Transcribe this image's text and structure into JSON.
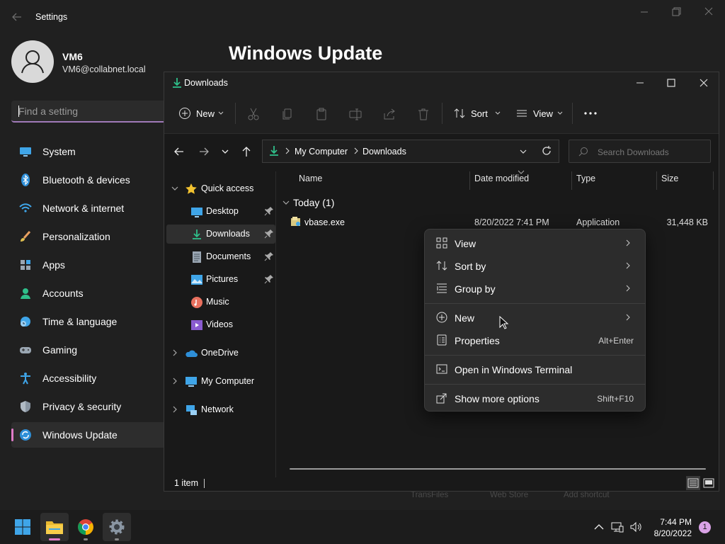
{
  "settings": {
    "app_title": "Settings",
    "user": {
      "name": "VM6",
      "email": "VM6@collabnet.local"
    },
    "search_placeholder": "Find a setting",
    "page_title": "Windows Update",
    "nav": [
      {
        "label": "System",
        "icon": "monitor-icon"
      },
      {
        "label": "Bluetooth & devices",
        "icon": "bluetooth-icon"
      },
      {
        "label": "Network & internet",
        "icon": "wifi-icon"
      },
      {
        "label": "Personalization",
        "icon": "brush-icon"
      },
      {
        "label": "Apps",
        "icon": "apps-icon"
      },
      {
        "label": "Accounts",
        "icon": "person-icon"
      },
      {
        "label": "Time & language",
        "icon": "clock-globe-icon"
      },
      {
        "label": "Gaming",
        "icon": "gamepad-icon"
      },
      {
        "label": "Accessibility",
        "icon": "accessibility-icon"
      },
      {
        "label": "Privacy & security",
        "icon": "shield-icon"
      },
      {
        "label": "Windows Update",
        "icon": "update-icon",
        "active": true
      }
    ]
  },
  "explorer": {
    "title": "Downloads",
    "toolbar": {
      "new": "New",
      "sort": "Sort",
      "view": "View"
    },
    "breadcrumb": [
      "My Computer",
      "Downloads"
    ],
    "search_placeholder": "Search Downloads",
    "tree": {
      "quick_access": "Quick access",
      "items": [
        "Desktop",
        "Downloads",
        "Documents",
        "Pictures",
        "Music",
        "Videos"
      ],
      "onedrive": "OneDrive",
      "my_computer": "My Computer",
      "network": "Network"
    },
    "columns": {
      "name": "Name",
      "date": "Date modified",
      "type": "Type",
      "size": "Size"
    },
    "group": "Today (1)",
    "files": [
      {
        "name": "vbase.exe",
        "date": "8/20/2022 7:41 PM",
        "type": "Application",
        "size": "31,448 KB"
      }
    ],
    "status": "1 item"
  },
  "context_menu": {
    "view": "View",
    "sort_by": "Sort by",
    "group_by": "Group by",
    "new": "New",
    "properties": "Properties",
    "properties_shortcut": "Alt+Enter",
    "open_terminal": "Open in Windows Terminal",
    "show_more": "Show more options",
    "show_more_shortcut": "Shift+F10"
  },
  "background_ghost": {
    "a": "TransFiles",
    "b": "Web Store",
    "c": "Add shortcut"
  },
  "taskbar": {
    "time": "7:44 PM",
    "date": "8/20/2022",
    "notifications": "1"
  }
}
